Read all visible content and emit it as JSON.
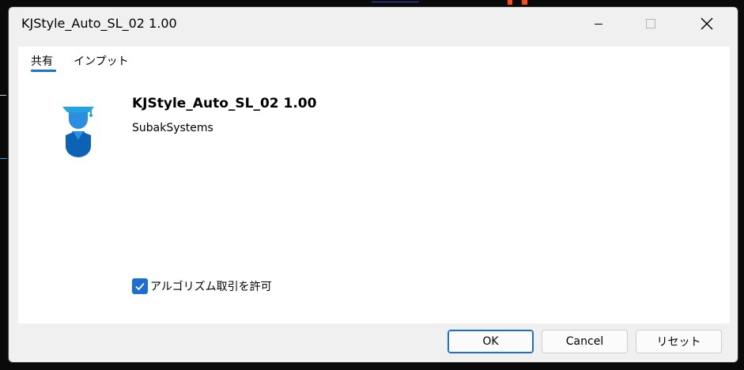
{
  "window": {
    "title": "KJStyle_Auto_SL_02 1.00",
    "controls": [
      "minimize-icon",
      "maximize-icon",
      "close-icon"
    ]
  },
  "tabs": [
    {
      "label": "共有",
      "active": true
    },
    {
      "label": "インプット",
      "active": false
    }
  ],
  "program": {
    "name": "KJStyle_Auto_SL_02 1.00",
    "author": "SubakSystems",
    "icon": "expert-advisor-icon"
  },
  "options": {
    "allow_algo_trading": {
      "label": "アルゴリズム取引を許可",
      "checked": true
    }
  },
  "buttons": {
    "ok": "OK",
    "cancel": "Cancel",
    "reset": "リセット"
  },
  "colors": {
    "accent": "#1a6fd0",
    "panel": "#ffffff",
    "dialog_bg": "#f0f0f0"
  }
}
